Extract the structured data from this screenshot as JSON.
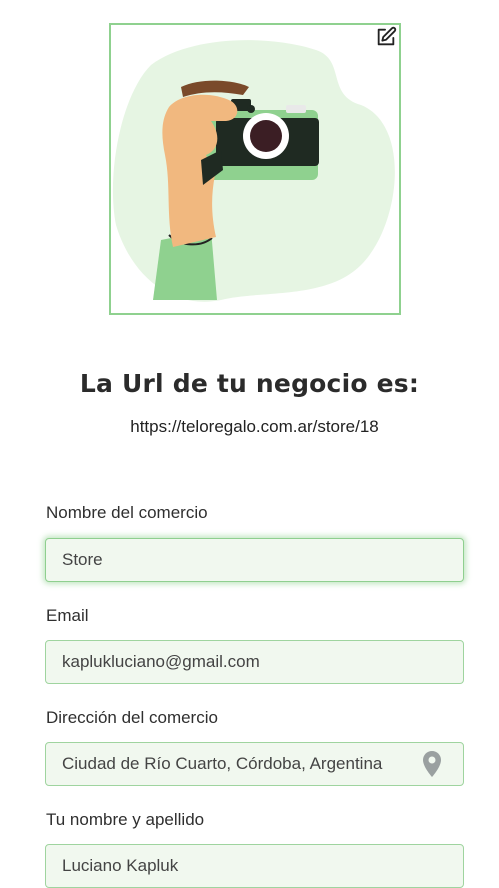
{
  "profile": {
    "photo_alt": "Ilustración de una mano sosteniendo una cámara",
    "edit_icon": "edit-icon"
  },
  "store_url": {
    "title": "La Url de tu negocio es:",
    "value": "https://teloregalo.com.ar/store/18"
  },
  "form": {
    "store_name": {
      "label": "Nombre del comercio",
      "value": "Store"
    },
    "email": {
      "label": "Email",
      "value": "kaplukluciano@gmail.com"
    },
    "address": {
      "label": "Dirección del comercio",
      "value": "Ciudad de Río Cuarto, Córdoba, Argentina",
      "icon": "location-pin-icon"
    },
    "full_name": {
      "label": "Tu nombre y apellido",
      "value": "Luciano Kapluk"
    }
  },
  "colors": {
    "accent": "#8fd18f",
    "field_bg": "#f1f8ef",
    "text": "#2b2b2b"
  }
}
